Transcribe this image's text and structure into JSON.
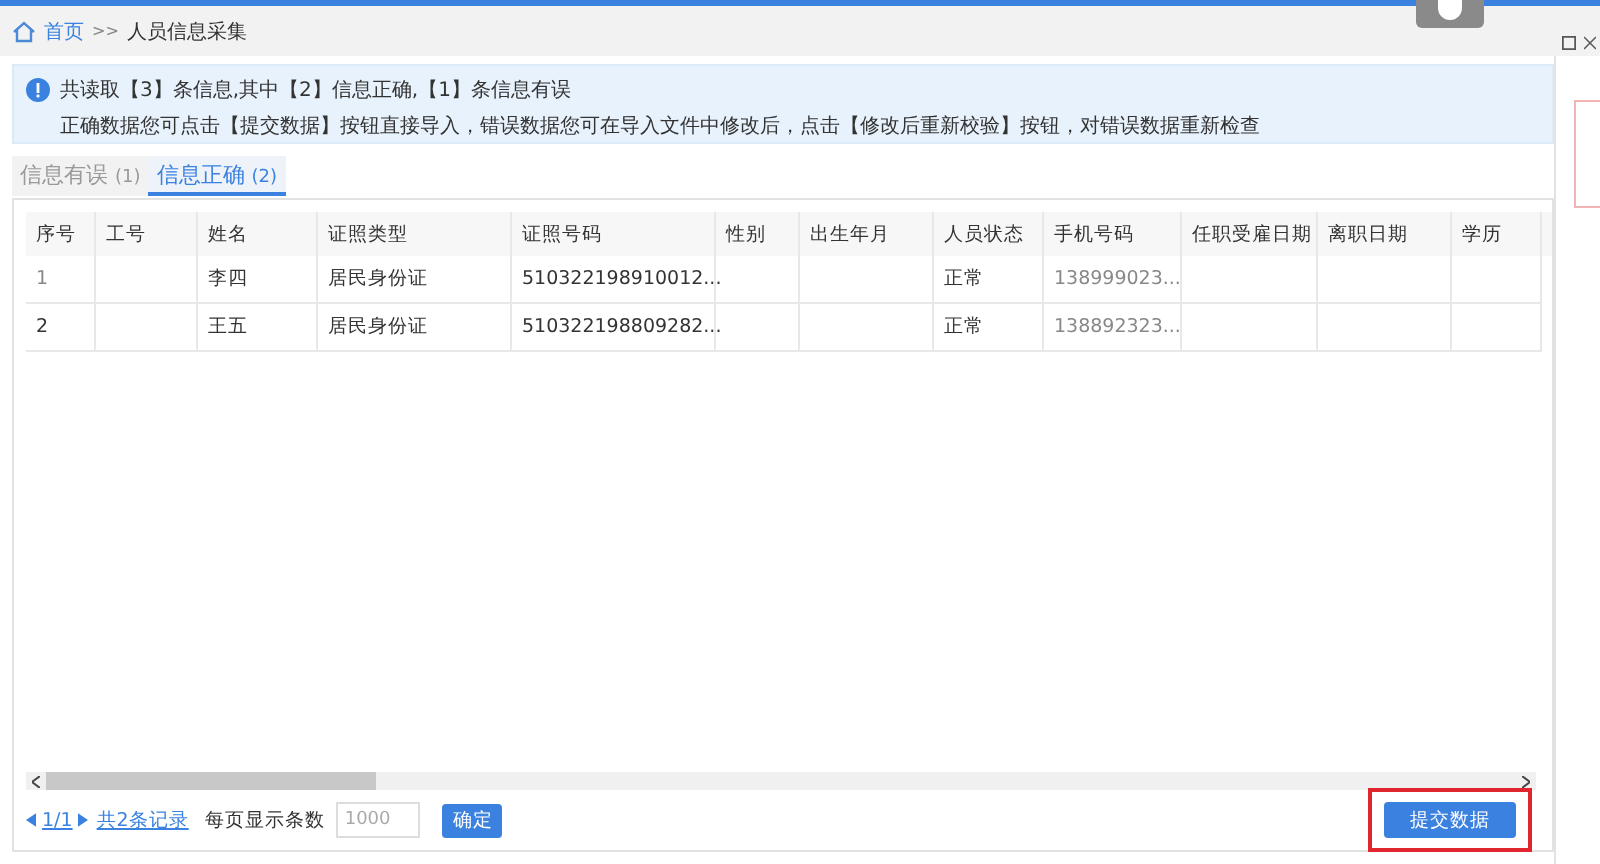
{
  "breadcrumb": {
    "home": "首页",
    "separator": ">>",
    "current": "人员信息采集"
  },
  "notice": {
    "summary": "共读取【3】条信息,其中【2】信息正确,【1】条信息有误",
    "hint": "正确数据您可点击【提交数据】按钮直接导入，错误数据您可在导入文件中修改后，点击【修改后重新校验】按钮，对错误数据重新检查"
  },
  "tabs": [
    {
      "label": "信息有误",
      "count": "(1)",
      "selected": false
    },
    {
      "label": "信息正确",
      "count": "(2)",
      "selected": true
    }
  ],
  "table": {
    "columns": [
      "序号",
      "工号",
      "姓名",
      "证照类型",
      "证照号码",
      "性别",
      "出生年月",
      "人员状态",
      "手机号码",
      "任职受雇日期",
      "离职日期",
      "学历"
    ],
    "rows": [
      [
        "1",
        "",
        "李四",
        "居民身份证",
        "510322198910012...",
        "",
        "",
        "正常",
        "138999023...",
        "",
        "",
        ""
      ],
      [
        "2",
        "",
        "王五",
        "居民身份证",
        "510322198809282...",
        "",
        "",
        "正常",
        "138892323...",
        "",
        "",
        ""
      ]
    ]
  },
  "pagination": {
    "page": "1/1",
    "total": "共2条记录",
    "page_size_label": "每页显示条数",
    "page_size": "1000",
    "confirm": "确定"
  },
  "submit_button": {
    "label": "提交数据",
    "highlighted": true
  }
}
